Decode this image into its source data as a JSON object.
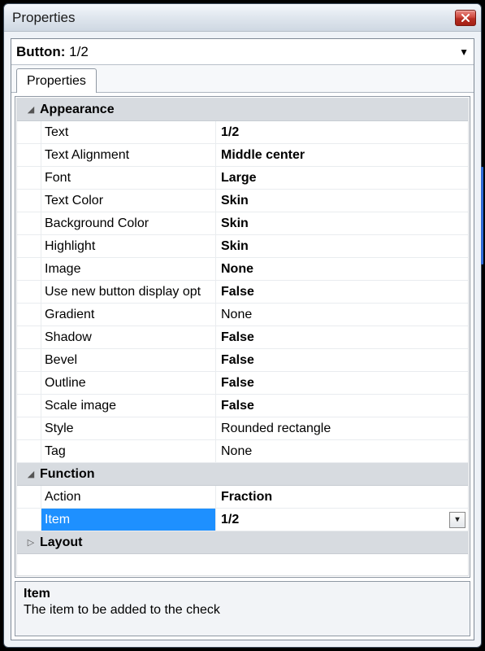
{
  "window": {
    "title": "Properties"
  },
  "dropdown": {
    "prefix": "Button:",
    "value": "1/2"
  },
  "tabs": [
    {
      "label": "Properties"
    }
  ],
  "desc": {
    "title": "Item",
    "text": "The item to be added to the check"
  },
  "groups": [
    {
      "name": "Appearance",
      "expanded": true,
      "rows": [
        {
          "name": "Text",
          "value": "1/2",
          "bold": true
        },
        {
          "name": "Text Alignment",
          "value": "Middle center",
          "bold": true
        },
        {
          "name": "Font",
          "value": "Large",
          "bold": true
        },
        {
          "name": "Text Color",
          "value": "Skin",
          "bold": true
        },
        {
          "name": "Background Color",
          "value": "Skin",
          "bold": true
        },
        {
          "name": "Highlight",
          "value": "Skin",
          "bold": true
        },
        {
          "name": "Image",
          "value": "None",
          "bold": true
        },
        {
          "name": "Use new button display opt",
          "value": "False",
          "bold": true
        },
        {
          "name": "Gradient",
          "value": "None",
          "bold": false
        },
        {
          "name": "Shadow",
          "value": "False",
          "bold": true
        },
        {
          "name": "Bevel",
          "value": "False",
          "bold": true
        },
        {
          "name": "Outline",
          "value": "False",
          "bold": true
        },
        {
          "name": "Scale image",
          "value": "False",
          "bold": true
        },
        {
          "name": "Style",
          "value": "Rounded rectangle",
          "bold": false
        },
        {
          "name": "Tag",
          "value": "None",
          "bold": false
        }
      ]
    },
    {
      "name": "Function",
      "expanded": true,
      "rows": [
        {
          "name": "Action",
          "value": "Fraction",
          "bold": true
        },
        {
          "name": "Item",
          "value": "1/2",
          "bold": true,
          "selected": true,
          "dropdown": true
        }
      ]
    },
    {
      "name": "Layout",
      "expanded": false,
      "rows": []
    }
  ]
}
